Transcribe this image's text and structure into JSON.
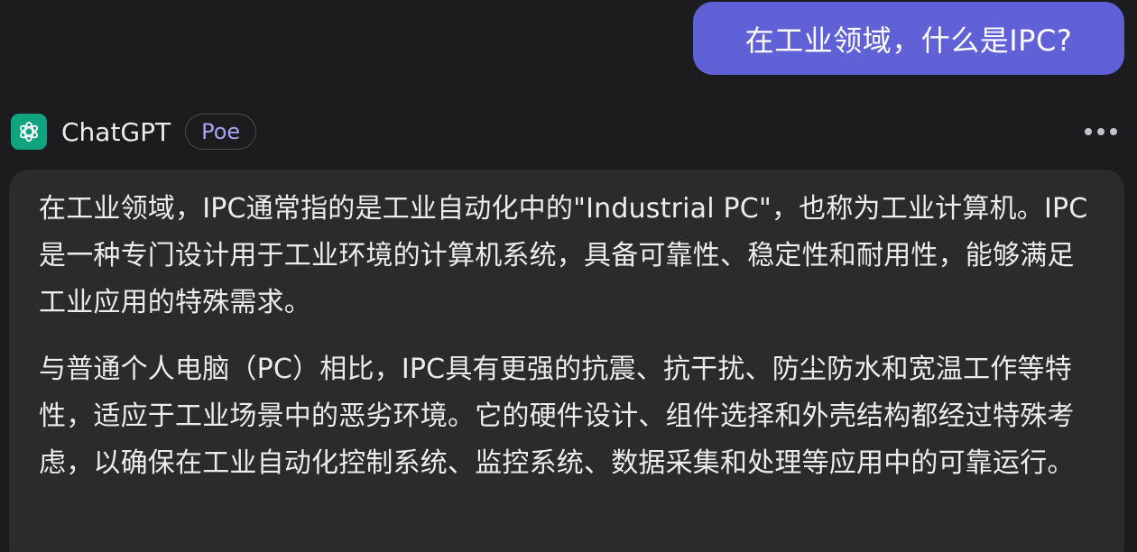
{
  "user_message": {
    "text": "在工业领域，什么是IPC?"
  },
  "bot": {
    "name": "ChatGPT",
    "badge": "Poe",
    "avatar_icon": "openai-logo-icon",
    "avatar_color": "#10a37f",
    "more_icon": "more-horizontal-icon",
    "paragraphs": [
      "在工业领域，IPC通常指的是工业自动化中的\"Industrial PC\"，也称为工业计算机。IPC是一种专门设计用于工业环境的计算机系统，具备可靠性、稳定性和耐用性，能够满足工业应用的特殊需求。",
      "与普通个人电脑（PC）相比，IPC具有更强的抗震、抗干扰、防尘防水和宽温工作等特性，适应于工业场景中的恶劣环境。它的硬件设计、组件选择和外壳结构都经过特殊考虑，以确保在工业自动化控制系统、监控系统、数据采集和处理等应用中的可靠运行。"
    ]
  },
  "colors": {
    "background": "#1c1c1e",
    "user_bubble": "#6061d6",
    "bot_bubble": "#2b2b2d",
    "badge_text": "#a4a6f5"
  }
}
